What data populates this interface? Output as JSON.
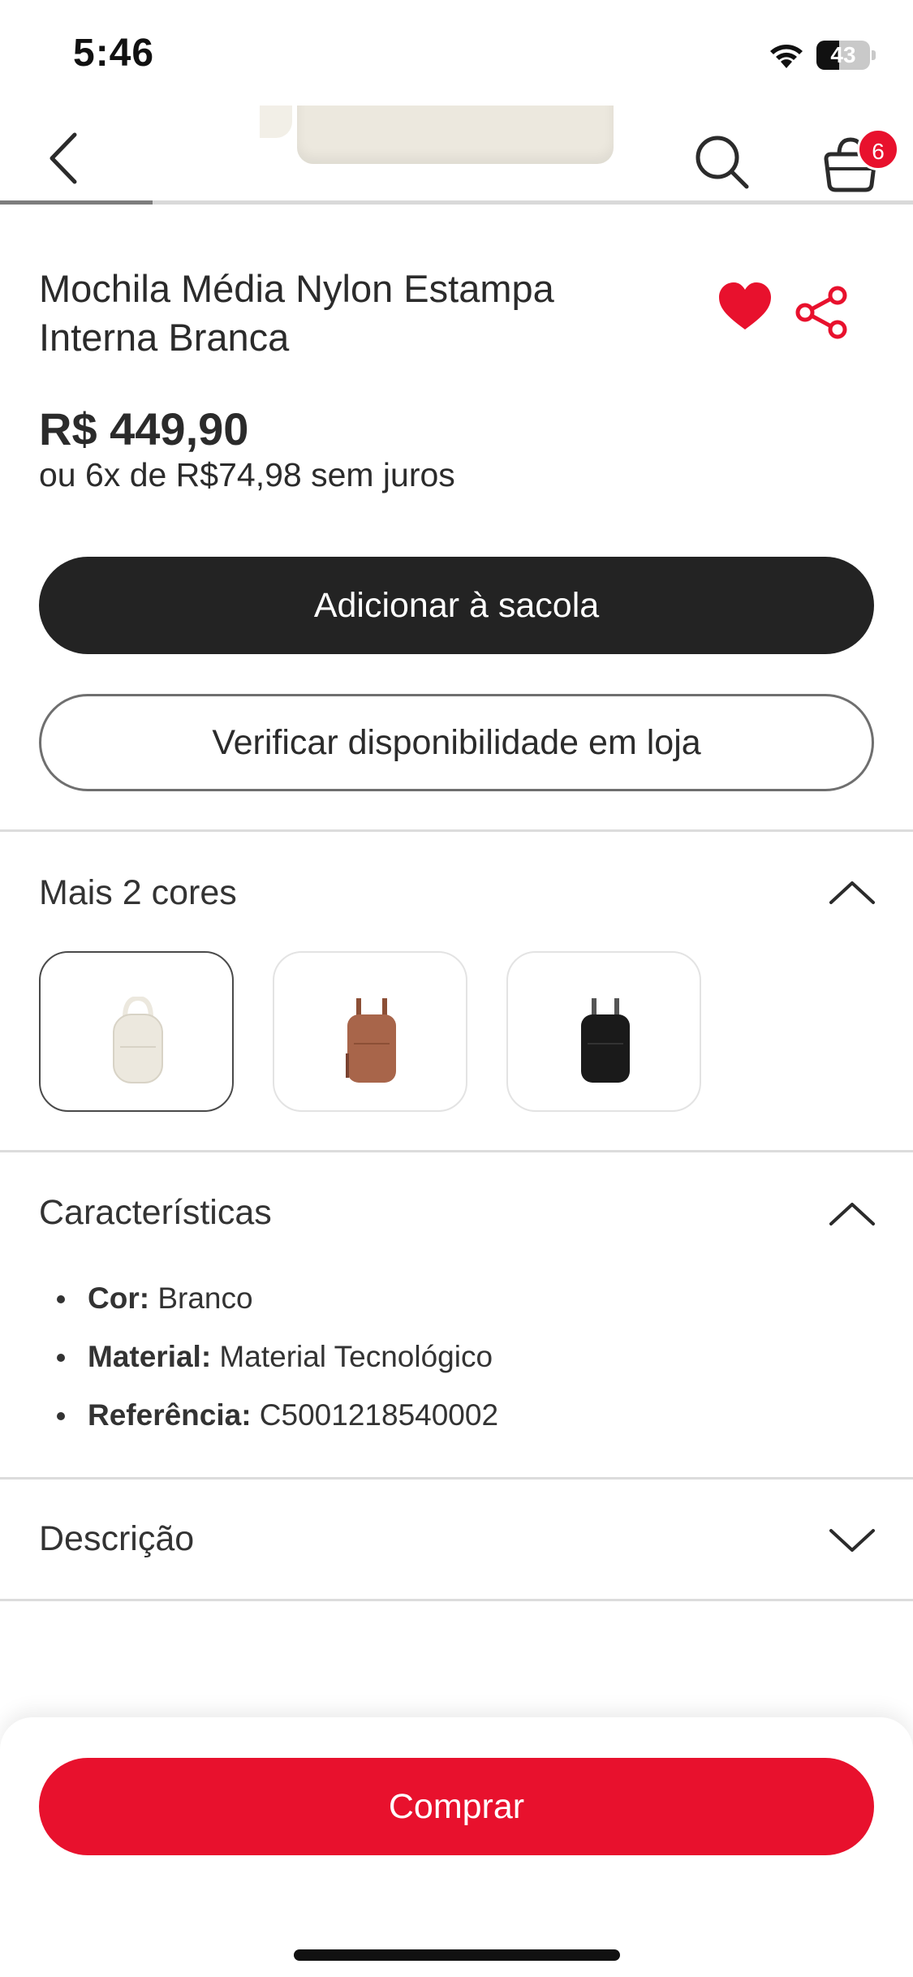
{
  "status_bar": {
    "time": "5:46",
    "battery_percent": "43",
    "battery_level": 0.43
  },
  "header": {
    "image_scroll_progress": 0.167,
    "cart_count": "6"
  },
  "product": {
    "title": "Mochila Média Nylon Estampa Interna Branca",
    "price": "R$ 449,90",
    "installments": "ou 6x de R$74,98 sem juros",
    "is_favorite": true
  },
  "actions": {
    "add_to_bag": "Adicionar à sacola",
    "check_store": "Verificar disponibilidade em loja"
  },
  "colors": {
    "title": "Mais 2 cores",
    "expanded": true,
    "swatches": [
      {
        "name": "branco",
        "color": "#ece8de",
        "selected": true
      },
      {
        "name": "marrom",
        "color": "#a8654a",
        "selected": false
      },
      {
        "name": "preto",
        "color": "#1a1a1a",
        "selected": false
      }
    ]
  },
  "characteristics": {
    "title": "Características",
    "expanded": true,
    "items": [
      {
        "key": "Cor:",
        "value": " Branco"
      },
      {
        "key": "Material:",
        "value": " Material Tecnológico"
      },
      {
        "key": "Referência:",
        "value": " C5001218540002"
      }
    ]
  },
  "description": {
    "title": "Descrição",
    "expanded": false
  },
  "buy": {
    "label": "Comprar"
  },
  "theme": {
    "accent": "#e8112d",
    "dark_button": "#232323"
  }
}
